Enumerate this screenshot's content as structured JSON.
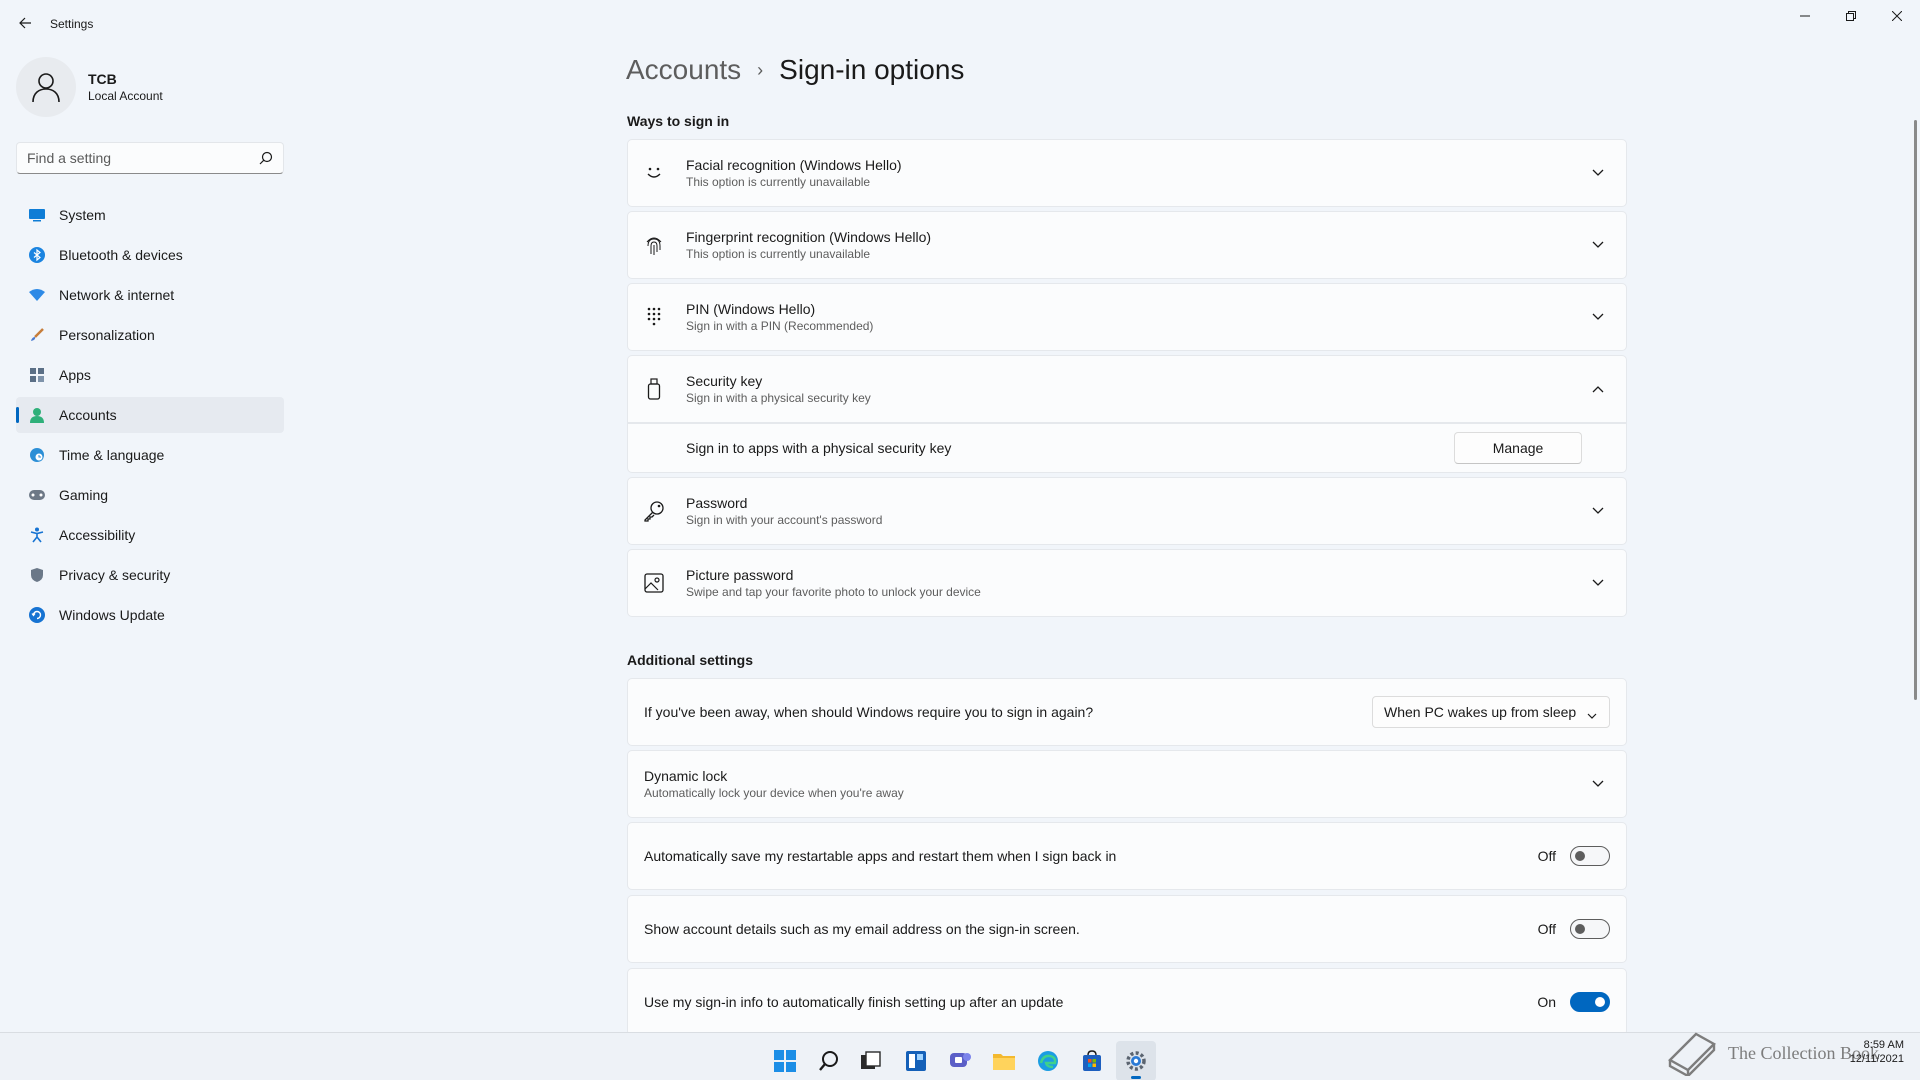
{
  "window": {
    "title": "Settings"
  },
  "profile": {
    "name": "TCB",
    "account_type": "Local Account"
  },
  "search": {
    "placeholder": "Find a setting"
  },
  "sidebar": {
    "items": [
      {
        "label": "System",
        "icon": "monitor-icon",
        "active": false
      },
      {
        "label": "Bluetooth & devices",
        "icon": "bluetooth-icon",
        "active": false
      },
      {
        "label": "Network & internet",
        "icon": "wifi-icon",
        "active": false
      },
      {
        "label": "Personalization",
        "icon": "brush-icon",
        "active": false
      },
      {
        "label": "Apps",
        "icon": "apps-icon",
        "active": false
      },
      {
        "label": "Accounts",
        "icon": "person-icon",
        "active": true
      },
      {
        "label": "Time & language",
        "icon": "globe-clock-icon",
        "active": false
      },
      {
        "label": "Gaming",
        "icon": "gamepad-icon",
        "active": false
      },
      {
        "label": "Accessibility",
        "icon": "accessibility-icon",
        "active": false
      },
      {
        "label": "Privacy & security",
        "icon": "shield-icon",
        "active": false
      },
      {
        "label": "Windows Update",
        "icon": "update-icon",
        "active": false
      }
    ]
  },
  "breadcrumb": {
    "parent": "Accounts",
    "separator": "›",
    "current": "Sign-in options"
  },
  "ways": {
    "heading": "Ways to sign in",
    "items": [
      {
        "title": "Facial recognition (Windows Hello)",
        "subtitle": "This option is currently unavailable",
        "icon": "face-icon"
      },
      {
        "title": "Fingerprint recognition (Windows Hello)",
        "subtitle": "This option is currently unavailable",
        "icon": "fingerprint-icon"
      },
      {
        "title": "PIN (Windows Hello)",
        "subtitle": "Sign in with a PIN (Recommended)",
        "icon": "pin-keypad-icon"
      },
      {
        "title": "Security key",
        "subtitle": "Sign in with a physical security key",
        "icon": "usb-key-icon"
      },
      {
        "title": "Password",
        "subtitle": "Sign in with your account's password",
        "icon": "key-icon"
      },
      {
        "title": "Picture password",
        "subtitle": "Swipe and tap your favorite photo to unlock your device",
        "icon": "picture-icon"
      }
    ],
    "security_key_detail": {
      "label": "Sign in to apps with a physical security key",
      "button": "Manage"
    }
  },
  "additional": {
    "heading": "Additional settings",
    "require_signin": {
      "label": "If you've been away, when should Windows require you to sign in again?",
      "value": "When PC wakes up from sleep"
    },
    "dynamic_lock": {
      "title": "Dynamic lock",
      "subtitle": "Automatically lock your device when you're away"
    },
    "toggles": [
      {
        "label": "Automatically save my restartable apps and restart them when I sign back in",
        "state": "Off",
        "on": false
      },
      {
        "label": "Show account details such as my email address on the sign-in screen.",
        "state": "Off",
        "on": false
      },
      {
        "label": "Use my sign-in info to automatically finish setting up after an update",
        "state": "On",
        "on": true
      }
    ]
  },
  "taskbar": {
    "icons": [
      "windows-start-icon",
      "search-icon",
      "task-view-icon",
      "widgets-icon",
      "chat-icon",
      "file-explorer-icon",
      "edge-icon",
      "store-icon",
      "settings-icon"
    ],
    "time": "8:59 AM",
    "date": "12/11/2021"
  },
  "watermark": {
    "text": "The Collection Book"
  },
  "colors": {
    "accent": "#0067c0",
    "background": "#f1f5fa",
    "card": "#fbfcfd"
  }
}
